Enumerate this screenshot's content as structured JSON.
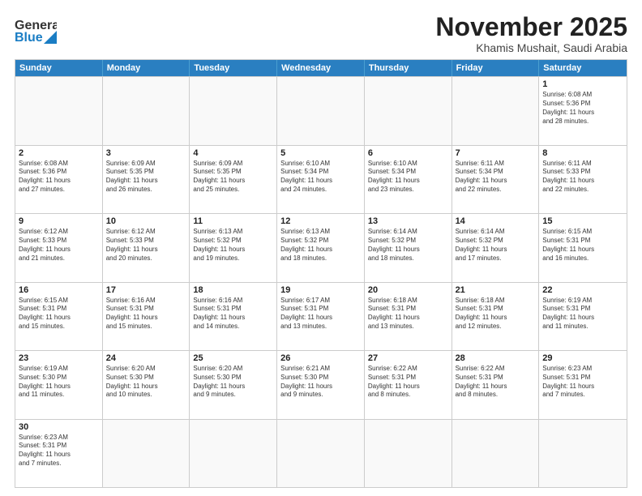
{
  "header": {
    "logo_general": "General",
    "logo_blue": "Blue",
    "title": "November 2025",
    "subtitle": "Khamis Mushait, Saudi Arabia"
  },
  "days": [
    "Sunday",
    "Monday",
    "Tuesday",
    "Wednesday",
    "Thursday",
    "Friday",
    "Saturday"
  ],
  "rows": [
    [
      {
        "day": "",
        "text": ""
      },
      {
        "day": "",
        "text": ""
      },
      {
        "day": "",
        "text": ""
      },
      {
        "day": "",
        "text": ""
      },
      {
        "day": "",
        "text": ""
      },
      {
        "day": "",
        "text": ""
      },
      {
        "day": "1",
        "text": "Sunrise: 6:08 AM\nSunset: 5:36 PM\nDaylight: 11 hours\nand 28 minutes."
      }
    ],
    [
      {
        "day": "2",
        "text": "Sunrise: 6:08 AM\nSunset: 5:36 PM\nDaylight: 11 hours\nand 27 minutes."
      },
      {
        "day": "3",
        "text": "Sunrise: 6:09 AM\nSunset: 5:35 PM\nDaylight: 11 hours\nand 26 minutes."
      },
      {
        "day": "4",
        "text": "Sunrise: 6:09 AM\nSunset: 5:35 PM\nDaylight: 11 hours\nand 25 minutes."
      },
      {
        "day": "5",
        "text": "Sunrise: 6:10 AM\nSunset: 5:34 PM\nDaylight: 11 hours\nand 24 minutes."
      },
      {
        "day": "6",
        "text": "Sunrise: 6:10 AM\nSunset: 5:34 PM\nDaylight: 11 hours\nand 23 minutes."
      },
      {
        "day": "7",
        "text": "Sunrise: 6:11 AM\nSunset: 5:34 PM\nDaylight: 11 hours\nand 22 minutes."
      },
      {
        "day": "8",
        "text": "Sunrise: 6:11 AM\nSunset: 5:33 PM\nDaylight: 11 hours\nand 22 minutes."
      }
    ],
    [
      {
        "day": "9",
        "text": "Sunrise: 6:12 AM\nSunset: 5:33 PM\nDaylight: 11 hours\nand 21 minutes."
      },
      {
        "day": "10",
        "text": "Sunrise: 6:12 AM\nSunset: 5:33 PM\nDaylight: 11 hours\nand 20 minutes."
      },
      {
        "day": "11",
        "text": "Sunrise: 6:13 AM\nSunset: 5:32 PM\nDaylight: 11 hours\nand 19 minutes."
      },
      {
        "day": "12",
        "text": "Sunrise: 6:13 AM\nSunset: 5:32 PM\nDaylight: 11 hours\nand 18 minutes."
      },
      {
        "day": "13",
        "text": "Sunrise: 6:14 AM\nSunset: 5:32 PM\nDaylight: 11 hours\nand 18 minutes."
      },
      {
        "day": "14",
        "text": "Sunrise: 6:14 AM\nSunset: 5:32 PM\nDaylight: 11 hours\nand 17 minutes."
      },
      {
        "day": "15",
        "text": "Sunrise: 6:15 AM\nSunset: 5:31 PM\nDaylight: 11 hours\nand 16 minutes."
      }
    ],
    [
      {
        "day": "16",
        "text": "Sunrise: 6:15 AM\nSunset: 5:31 PM\nDaylight: 11 hours\nand 15 minutes."
      },
      {
        "day": "17",
        "text": "Sunrise: 6:16 AM\nSunset: 5:31 PM\nDaylight: 11 hours\nand 15 minutes."
      },
      {
        "day": "18",
        "text": "Sunrise: 6:16 AM\nSunset: 5:31 PM\nDaylight: 11 hours\nand 14 minutes."
      },
      {
        "day": "19",
        "text": "Sunrise: 6:17 AM\nSunset: 5:31 PM\nDaylight: 11 hours\nand 13 minutes."
      },
      {
        "day": "20",
        "text": "Sunrise: 6:18 AM\nSunset: 5:31 PM\nDaylight: 11 hours\nand 13 minutes."
      },
      {
        "day": "21",
        "text": "Sunrise: 6:18 AM\nSunset: 5:31 PM\nDaylight: 11 hours\nand 12 minutes."
      },
      {
        "day": "22",
        "text": "Sunrise: 6:19 AM\nSunset: 5:31 PM\nDaylight: 11 hours\nand 11 minutes."
      }
    ],
    [
      {
        "day": "23",
        "text": "Sunrise: 6:19 AM\nSunset: 5:30 PM\nDaylight: 11 hours\nand 11 minutes."
      },
      {
        "day": "24",
        "text": "Sunrise: 6:20 AM\nSunset: 5:30 PM\nDaylight: 11 hours\nand 10 minutes."
      },
      {
        "day": "25",
        "text": "Sunrise: 6:20 AM\nSunset: 5:30 PM\nDaylight: 11 hours\nand 9 minutes."
      },
      {
        "day": "26",
        "text": "Sunrise: 6:21 AM\nSunset: 5:30 PM\nDaylight: 11 hours\nand 9 minutes."
      },
      {
        "day": "27",
        "text": "Sunrise: 6:22 AM\nSunset: 5:31 PM\nDaylight: 11 hours\nand 8 minutes."
      },
      {
        "day": "28",
        "text": "Sunrise: 6:22 AM\nSunset: 5:31 PM\nDaylight: 11 hours\nand 8 minutes."
      },
      {
        "day": "29",
        "text": "Sunrise: 6:23 AM\nSunset: 5:31 PM\nDaylight: 11 hours\nand 7 minutes."
      }
    ],
    [
      {
        "day": "30",
        "text": "Sunrise: 6:23 AM\nSunset: 5:31 PM\nDaylight: 11 hours\nand 7 minutes."
      },
      {
        "day": "",
        "text": ""
      },
      {
        "day": "",
        "text": ""
      },
      {
        "day": "",
        "text": ""
      },
      {
        "day": "",
        "text": ""
      },
      {
        "day": "",
        "text": ""
      },
      {
        "day": "",
        "text": ""
      }
    ]
  ]
}
